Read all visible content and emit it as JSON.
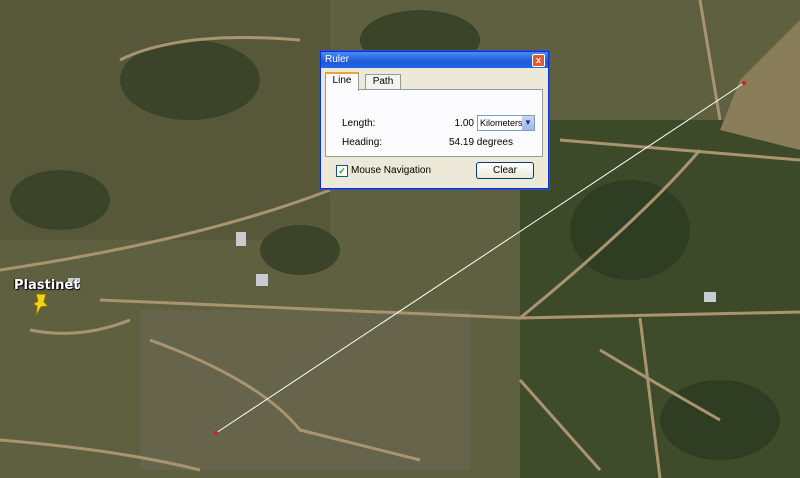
{
  "map": {
    "placemark": {
      "label": "Plastinet",
      "color": "#f2d21b"
    },
    "ruler_line_color": "#ffffff",
    "endpoint_color": "#d81e1e"
  },
  "ruler": {
    "title": "Ruler",
    "close_glyph": "x",
    "tabs": [
      {
        "label": "Line"
      },
      {
        "label": "Path"
      }
    ],
    "length_label": "Length:",
    "length_value": "1.00",
    "units": "Kilometers",
    "heading_label": "Heading:",
    "heading_value": "54.19 degrees",
    "mouse_nav_label": "Mouse Navigation",
    "mouse_nav_checked": true,
    "check_glyph": "✓",
    "clear_label": "Clear"
  }
}
